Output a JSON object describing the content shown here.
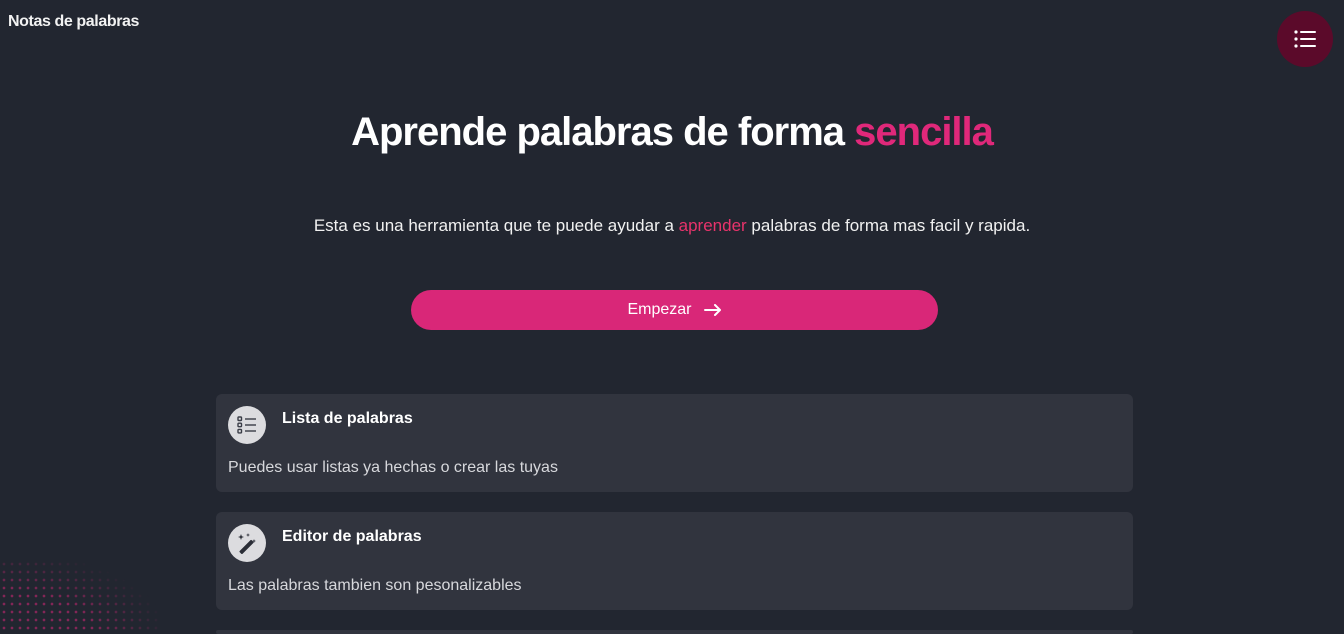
{
  "header": {
    "brand": "Notas de palabras",
    "menu_icon": "list-icon"
  },
  "hero": {
    "title_main": "Aprende palabras de forma ",
    "title_accent": "sencilla",
    "subtitle_before": "Esta es una herramienta que te puede ayudar a ",
    "subtitle_accent": "aprender",
    "subtitle_after": " palabras de forma mas facil y rapida.",
    "cta_label": "Empezar",
    "cta_icon": "arrow-right-icon"
  },
  "features": [
    {
      "title": "Lista de palabras",
      "description": "Puedes usar listas ya hechas o crear las tuyas",
      "icon": "checklist-icon"
    },
    {
      "title": "Editor de palabras",
      "description": "Las palabras tambien son pesonalizables",
      "icon": "magic-wand-icon"
    }
  ],
  "colors": {
    "background": "#222630",
    "accent": "#d92778",
    "card": "#31343e",
    "menu_button": "#5b0a2a"
  }
}
